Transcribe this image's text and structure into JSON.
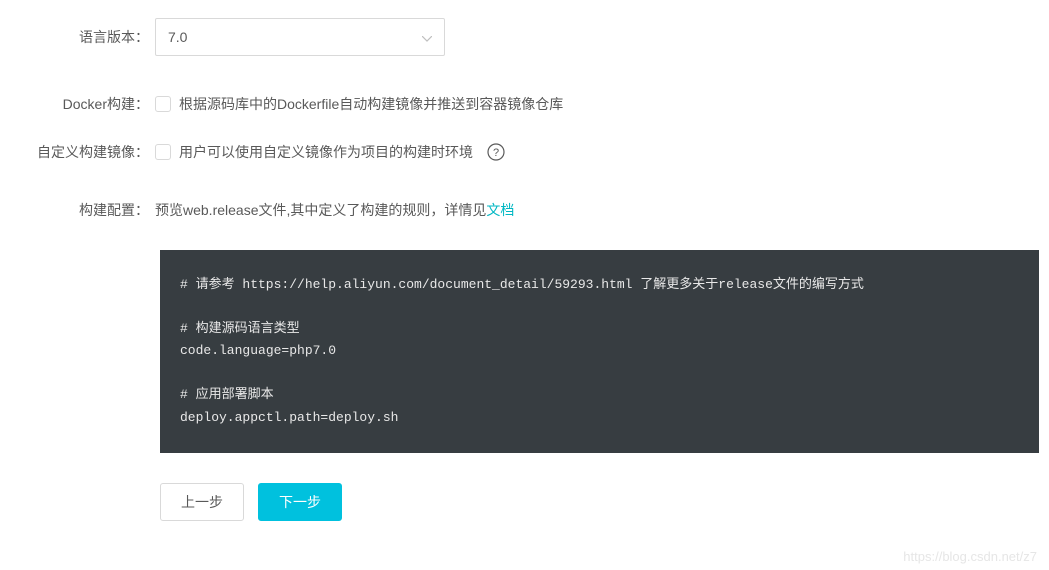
{
  "labels": {
    "language_version": "语言版本：",
    "docker_build": "Docker构建：",
    "custom_image": "自定义构建镜像：",
    "build_config": "构建配置："
  },
  "language_version": {
    "value": "7.0"
  },
  "docker_build": {
    "text": "根据源码库中的Dockerfile自动构建镜像并推送到容器镜像仓库"
  },
  "custom_image": {
    "text": "用户可以使用自定义镜像作为项目的构建时环境"
  },
  "build_config": {
    "prefix": "预览web.release文件,其中定义了构建的规则，详情见",
    "link": "文档"
  },
  "code": "# 请参考 https://help.aliyun.com/document_detail/59293.html 了解更多关于release文件的编写方式\n\n# 构建源码语言类型\ncode.language=php7.0\n\n# 应用部署脚本\ndeploy.appctl.path=deploy.sh",
  "buttons": {
    "prev": "上一步",
    "next": "下一步"
  },
  "watermark": "https://blog.csdn.net/z7"
}
